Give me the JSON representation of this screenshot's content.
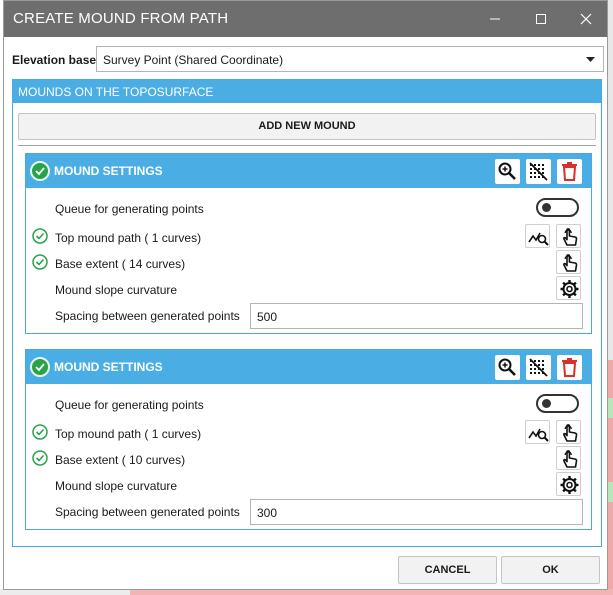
{
  "window": {
    "title": "CREATE MOUND FROM PATH",
    "minimize_icon": "minimize-icon",
    "maximize_icon": "maximize-icon",
    "close_icon": "close-icon"
  },
  "elevation": {
    "label": "Elevation base",
    "selected": "Survey Point (Shared Coordinate)"
  },
  "mounds_panel": {
    "header": "MOUNDS ON THE TOPOSURFACE",
    "add_button": "ADD NEW MOUND"
  },
  "mounds": [
    {
      "title": "MOUND SETTINGS",
      "queue_label": "Queue for generating points",
      "queue_enabled": false,
      "top_path_label": "Top mound path ( 1  curves)",
      "base_extent_label": "Base extent ( 14  curves)",
      "slope_label": "Mound slope curvature",
      "spacing_label": "Spacing between generated points",
      "spacing_value": "500"
    },
    {
      "title": "MOUND SETTINGS",
      "queue_label": "Queue for generating points",
      "queue_enabled": false,
      "top_path_label": "Top mound path ( 1  curves)",
      "base_extent_label": "Base extent ( 10  curves)",
      "slope_label": "Mound slope curvature",
      "spacing_label": "Spacing between generated points",
      "spacing_value": "300"
    }
  ],
  "footer": {
    "cancel": "CANCEL",
    "ok": "OK"
  },
  "colors": {
    "accent": "#4aaee4",
    "titlebar": "#6e6e6e",
    "check_green": "#29a34a",
    "delete_red": "#d9302c"
  }
}
